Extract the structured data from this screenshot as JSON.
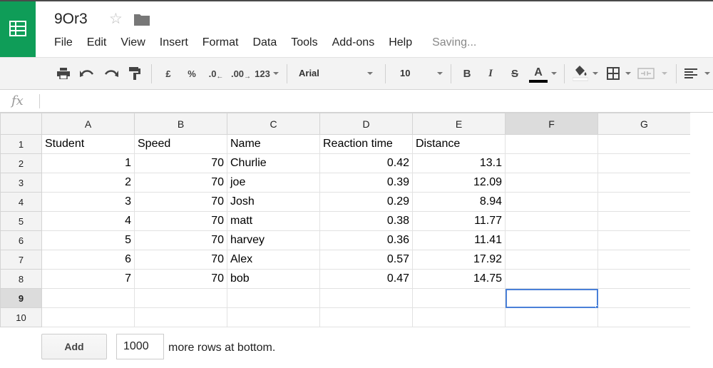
{
  "header": {
    "title": "9Or3",
    "saving_status": "Saving...",
    "menu": [
      "File",
      "Edit",
      "View",
      "Insert",
      "Format",
      "Data",
      "Tools",
      "Add-ons",
      "Help"
    ]
  },
  "toolbar": {
    "currency_label": "£",
    "percent_label": "%",
    "decrease_decimal_label": ".0",
    "increase_decimal_label": ".00",
    "number_format_label": "123",
    "font_name": "Arial",
    "font_size": "10",
    "bold_label": "B",
    "italic_label": "I",
    "strikethrough_label": "S",
    "text_color_label": "A"
  },
  "formula_bar": {
    "fx_label": "fx",
    "value": ""
  },
  "grid": {
    "columns": [
      "A",
      "B",
      "C",
      "D",
      "E",
      "F",
      "G"
    ],
    "selected_column": "F",
    "selected_row": "9",
    "rows": [
      {
        "n": "1",
        "cells": [
          "Student",
          "Speed",
          "Name",
          "Reaction time",
          "Distance",
          "",
          ""
        ]
      },
      {
        "n": "2",
        "cells": [
          "1",
          "70",
          "Churlie",
          "0.42",
          "13.1",
          "",
          ""
        ]
      },
      {
        "n": "3",
        "cells": [
          "2",
          "70",
          "joe",
          "0.39",
          "12.09",
          "",
          ""
        ]
      },
      {
        "n": "4",
        "cells": [
          "3",
          "70",
          "Josh",
          "0.29",
          "8.94",
          "",
          ""
        ]
      },
      {
        "n": "5",
        "cells": [
          "4",
          "70",
          "matt",
          "0.38",
          "11.77",
          "",
          ""
        ]
      },
      {
        "n": "6",
        "cells": [
          "5",
          "70",
          "harvey",
          "0.36",
          "11.41",
          "",
          ""
        ]
      },
      {
        "n": "7",
        "cells": [
          "6",
          "70",
          "Alex",
          "0.57",
          "17.92",
          "",
          ""
        ]
      },
      {
        "n": "8",
        "cells": [
          "7",
          "70",
          "bob",
          "0.47",
          "14.75",
          "",
          ""
        ]
      },
      {
        "n": "9",
        "cells": [
          "",
          "",
          "",
          "",
          "",
          "",
          ""
        ]
      },
      {
        "n": "10",
        "cells": [
          "",
          "",
          "",
          "",
          "",
          "",
          ""
        ]
      }
    ]
  },
  "footer": {
    "add_label": "Add",
    "rows_value": "1000",
    "more_rows_label": "more rows at bottom."
  },
  "colors": {
    "brand_green": "#0f9d58",
    "selection_blue": "#4a80d8"
  }
}
